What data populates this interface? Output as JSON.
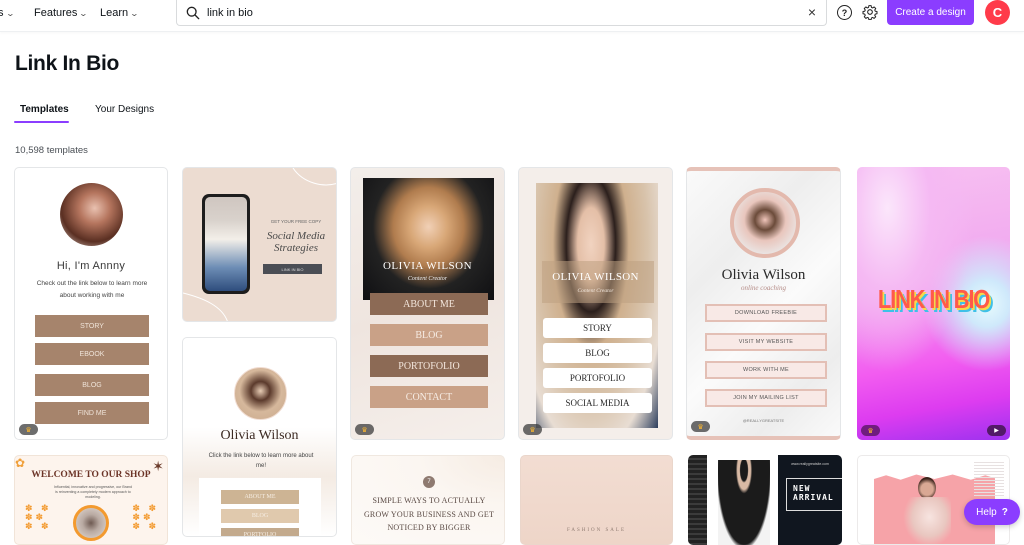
{
  "topbar": {
    "nav": [
      {
        "label": "s",
        "icon": "chevron-down-icon"
      },
      {
        "label": "Features",
        "icon": "chevron-down-icon"
      },
      {
        "label": "Learn",
        "icon": "chevron-down-icon"
      }
    ],
    "search": {
      "value": "link in bio",
      "placeholder": "Search",
      "clear_icon": "×"
    },
    "help_icon": "?",
    "create_button": "Create a design",
    "avatar_initial": "C"
  },
  "page": {
    "title": "Link In Bio",
    "tabs": [
      {
        "label": "Templates",
        "active": true
      },
      {
        "label": "Your Designs",
        "active": false
      }
    ],
    "count": "10,598 templates"
  },
  "templates": [
    {
      "id": "annny",
      "heading": "Hi, I'm Annny",
      "subtext": "Check out the link below to learn more about working with me",
      "buttons": [
        "STORY",
        "EBOOK",
        "BLOG",
        "FIND ME"
      ],
      "premium": true
    },
    {
      "id": "social-media",
      "kicker": "GET YOUR FREE COPY",
      "title_line1": "Social Media",
      "title_line2": "Strategies",
      "button": "LINK IN BIO"
    },
    {
      "id": "olivia-about",
      "name": "Olivia Wilson",
      "subtext": "Click the link below to learn more about me!",
      "buttons": [
        "ABOUT ME",
        "BLOG",
        "PORTFOLIO"
      ]
    },
    {
      "id": "olivia-content-creator",
      "name": "OLIVIA WILSON",
      "tagline": "Content Creator",
      "buttons": [
        "ABOUT ME",
        "BLOG",
        "PORTOFOLIO",
        "CONTACT"
      ],
      "premium": true
    },
    {
      "id": "olivia-story",
      "name": "OLIVIA WILSON",
      "tagline": "Content Creator",
      "buttons": [
        "STORY",
        "BLOG",
        "PORTOFOLIO",
        "SOCIAL MEDIA"
      ],
      "premium": true
    },
    {
      "id": "olivia-coaching",
      "name": "Olivia Wilson",
      "tagline": "online coaching",
      "buttons": [
        "DOWNLOAD FREEBIE",
        "VISIT MY WEBSITE",
        "WORK WITH ME",
        "JOIN MY MAILING LIST"
      ],
      "handle": "@REALLYGREATSITE",
      "premium": true
    },
    {
      "id": "link-in-bio-gradient",
      "title": "LINK IN BIO",
      "premium": true,
      "video": true
    },
    {
      "id": "welcome-shop",
      "title": "WELCOME TO OUR SHOP",
      "subtext": "Influential, innovative and progressive, our Brand is reinventing a completely modern approach to modeling."
    },
    {
      "id": "simple-ways",
      "badge": "7",
      "text": "SIMPLE WAYS TO ACTUALLY GROW YOUR BUSINESS AND GET NOTICED BY BIGGER"
    },
    {
      "id": "fashion-sale",
      "text": "FASHION SALE"
    },
    {
      "id": "new-arrival",
      "site": "www.reallygreatsite.com",
      "title_line1": "NEW",
      "title_line2": "ARRIVAL"
    },
    {
      "id": "pink-fashion"
    }
  ],
  "help_fab": {
    "label": "Help",
    "icon": "?"
  }
}
